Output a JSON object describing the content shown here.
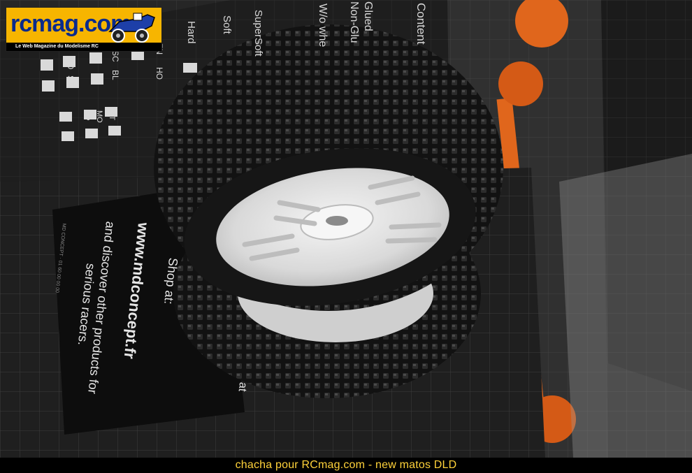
{
  "photo": {
    "description_alt": "Product photo",
    "colors": {
      "box_dark": "#2b2b2b",
      "accent_orange": "#e0661c",
      "tire_black": "#1a1a1a",
      "rim_white": "#e8e8e8",
      "caption_yellow": "#ffd23a",
      "logo_orange": "#f7b500",
      "logo_blue": "#0a2b8c"
    }
  },
  "logo": {
    "wordmark": "rcmag.com",
    "tagline": "Le Web Magazine du Modelisme RC"
  },
  "box_labels": {
    "content": "Content",
    "glued": "Glued",
    "non_glued": "Non-Glu",
    "wo_wheel": "W/o whe",
    "supersoft": "SuperSoft",
    "soft": "Soft",
    "hard": "Hard",
    "codes": [
      "ZN",
      "HO",
      "SC",
      "BL",
      "MO",
      "ST",
      "SP",
      "MO",
      "ST"
    ]
  },
  "card": {
    "line1": "Shop at:",
    "line2": "www.mdconcept.fr",
    "line3": "and discover other products for",
    "line4": "serious racers.",
    "fragment": "at",
    "small_print": "MD CONCEPT · 01 60 00 00 00"
  },
  "caption": {
    "text": "chacha pour RCmag.com - new matos DLD"
  }
}
